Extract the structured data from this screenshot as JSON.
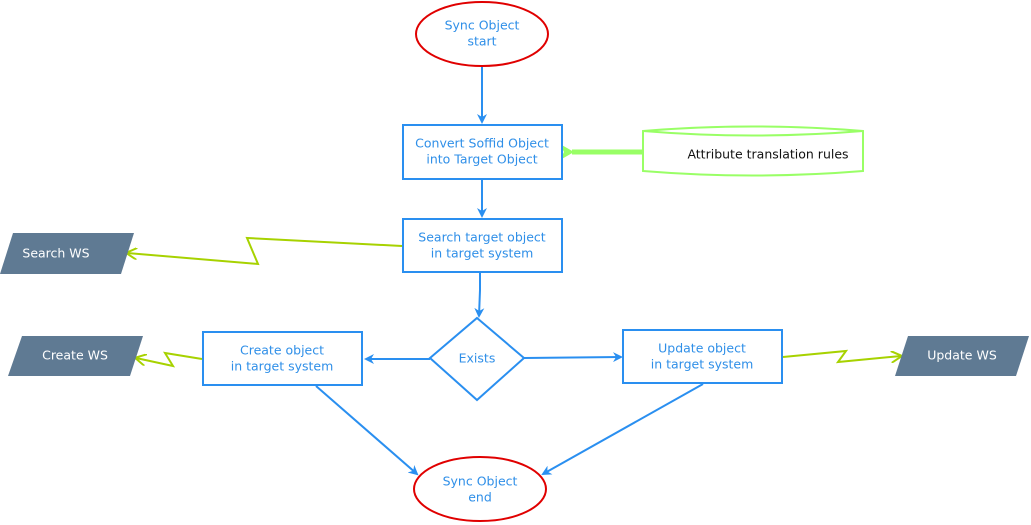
{
  "colors": {
    "flow_blue": "#2a8ff0",
    "terminal_red": "#e00000",
    "io_fill": "#5f7a93",
    "green_link": "#a7d200",
    "bright_green": "#99ff66"
  },
  "nodes": {
    "start": {
      "line1": "Sync Object",
      "line2": "start"
    },
    "convert": {
      "line1": "Convert Soffid Object",
      "line2": "into Target Object"
    },
    "rules": {
      "label": "Attribute translation rules"
    },
    "search": {
      "line1": "Search target object",
      "line2": "in target system"
    },
    "search_ws": {
      "label": "Search WS"
    },
    "exists": {
      "label": "Exists"
    },
    "create": {
      "line1": "Create object",
      "line2": "in target system"
    },
    "create_ws": {
      "label": "Create WS"
    },
    "update": {
      "line1": "Update object",
      "line2": "in target system"
    },
    "update_ws": {
      "label": "Update WS"
    },
    "end": {
      "line1": "Sync Object",
      "line2": "end"
    }
  }
}
